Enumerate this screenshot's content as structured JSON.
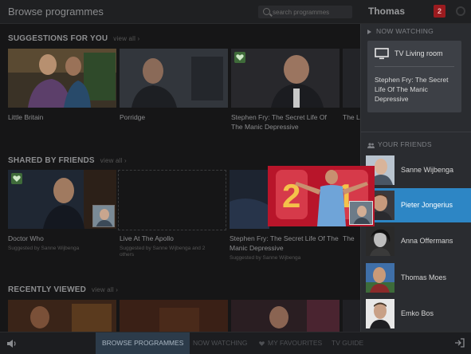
{
  "header": {
    "title": "Browse programmes",
    "search_placeholder": "search programmes",
    "user": "Thomas",
    "notifications": "2"
  },
  "sections": {
    "suggestions": {
      "title": "SUGGESTIONS FOR YOU",
      "view_all": "view all ›",
      "items": [
        {
          "title": "Little Britain"
        },
        {
          "title": "Porridge"
        },
        {
          "title": "Stephen Fry: The Secret Life Of The Manic Depressive"
        },
        {
          "title": "The L"
        }
      ]
    },
    "shared": {
      "title": "SHARED BY FRIENDS",
      "view_all": "view all ›",
      "items": [
        {
          "title": "Doctor Who",
          "sub": "Suggested by Sanne Wijbenga"
        },
        {
          "title": "Live At The Apollo",
          "sub": "Suggested by Sanne Wijbenga and 2 others"
        },
        {
          "title": "Stephen Fry: The Secret Life Of The Manic Depressive",
          "sub": "Suggested by Sanne Wijbenga"
        },
        {
          "title": "The"
        }
      ]
    },
    "recent": {
      "title": "RECENTLY VIEWED",
      "view_all": "view all ›"
    }
  },
  "panel": {
    "now_watching_label": "NOW WATCHING",
    "device": "TV Living room",
    "programme": "Stephen Fry: The Secret Life Of The Manic Depressive",
    "friends_label": "YOUR FRIENDS",
    "friends": [
      {
        "name": "Sanne Wijbenga"
      },
      {
        "name": "Pieter Jongerius"
      },
      {
        "name": "Anna Offermans"
      },
      {
        "name": "Thomas Moes"
      },
      {
        "name": "Emko Bos"
      }
    ]
  },
  "bottom_nav": {
    "browse": "BROWSE PROGRAMMES",
    "now": "NOW WATCHING",
    "favourites": "MY FAVOURITES",
    "tv_guide": "TV GUIDE"
  },
  "colors": {
    "accent_blue": "#2d86c5",
    "badge_red": "#9b1b1f",
    "heart_green": "#3f6b3a"
  }
}
